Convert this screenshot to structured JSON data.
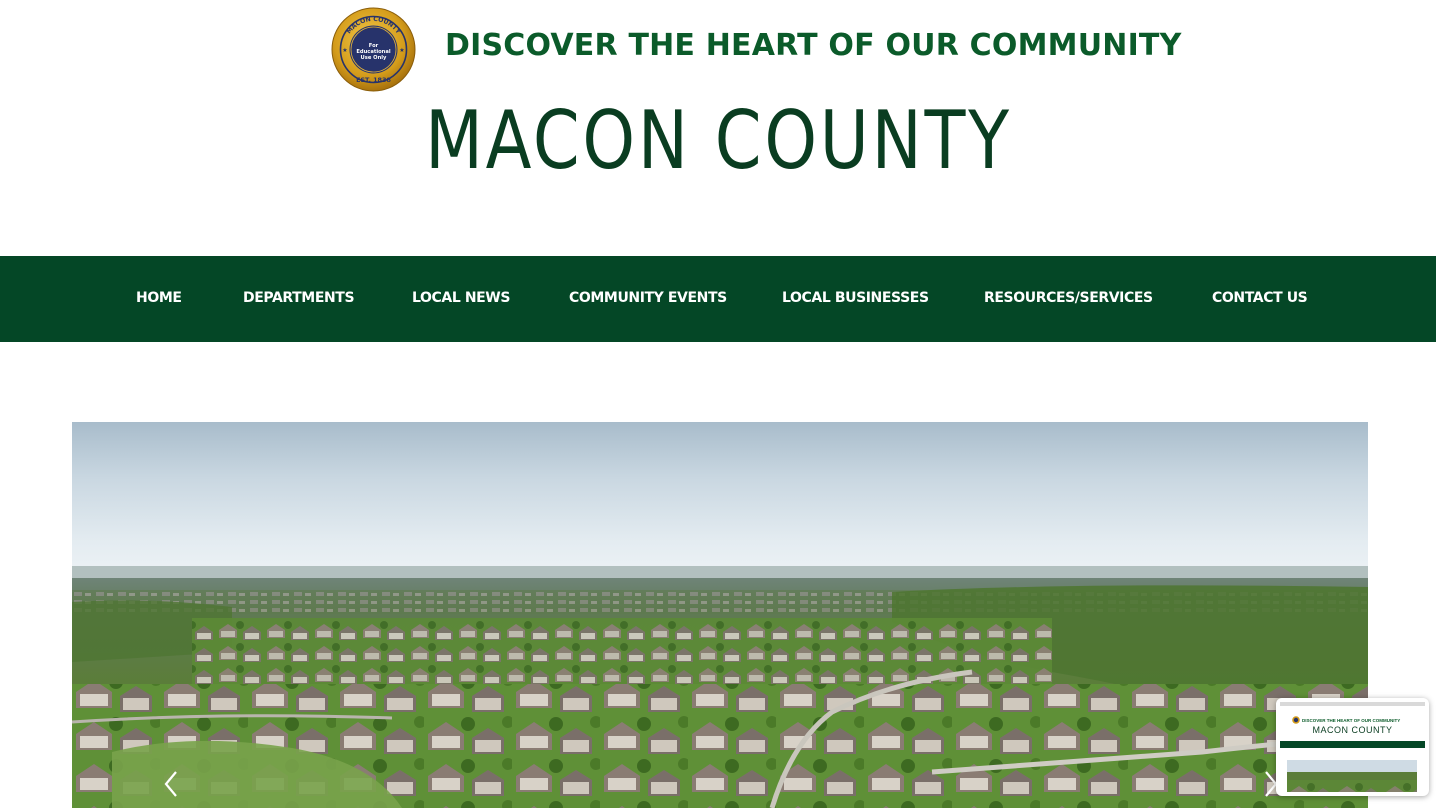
{
  "header": {
    "seal": {
      "top_text": "MACON COUNTY",
      "ring_text": "OFFICIAL SEAL • STATE OF TENNESSEE",
      "center_text": "For Educational Use Only",
      "bottom_text": "EST. 1838"
    },
    "tagline": "DISCOVER THE HEART OF OUR COMMUNITY",
    "site_title": "MACON COUNTY"
  },
  "nav": {
    "items": [
      {
        "label": "HOME"
      },
      {
        "label": "DEPARTMENTS"
      },
      {
        "label": "LOCAL NEWS"
      },
      {
        "label": "COMMUNITY EVENTS"
      },
      {
        "label": "LOCAL BUSINESSES"
      },
      {
        "label": "RESOURCES/SERVICES"
      },
      {
        "label": "CONTACT US"
      }
    ]
  },
  "hero": {
    "image": "aerial-suburban-neighborhood-photo",
    "prev_icon": "chevron-left-icon",
    "next_icon": "chevron-right-icon"
  },
  "thumbnail": {
    "tagline": "DISCOVER THE HEART OF OUR COMMUNITY",
    "title": "MACON COUNTY"
  },
  "colors": {
    "brand_green": "#0b5b2a",
    "title_green": "#0a3d21",
    "nav_background": "#044726",
    "seal_gold": "#d9a521",
    "seal_blue": "#27336b"
  }
}
